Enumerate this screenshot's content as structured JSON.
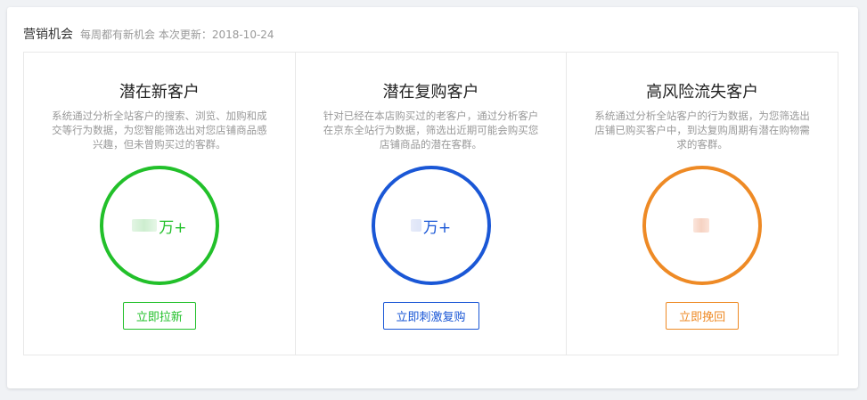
{
  "header": {
    "title": "营销机会",
    "subtitle": "每周都有新机会 本次更新：2018-10-24"
  },
  "colors": {
    "green": "#22c02a",
    "blue": "#1a57d6",
    "orange": "#ee8a25"
  },
  "cards": [
    {
      "title": "潜在新客户",
      "description": "系统通过分析全站客户的搜索、浏览、加购和成交等行为数据，为您智能筛选出对您店铺商品感兴趣，但未曾购买过的客群。",
      "count_unit": "万+",
      "action_label": "立即拉新",
      "color": "green"
    },
    {
      "title": "潜在复购客户",
      "description": "针对已经在本店购买过的老客户，通过分析客户在京东全站行为数据，筛选出近期可能会购买您店铺商品的潜在客群。",
      "count_unit": "万+",
      "action_label": "立即刺激复购",
      "color": "blue"
    },
    {
      "title": "高风险流失客户",
      "description": "系统通过分析全站客户的行为数据，为您筛选出店铺已购买客户中，到达复购周期有潜在购物需求的客群。",
      "count_unit": "",
      "action_label": "立即挽回",
      "color": "orange"
    }
  ]
}
